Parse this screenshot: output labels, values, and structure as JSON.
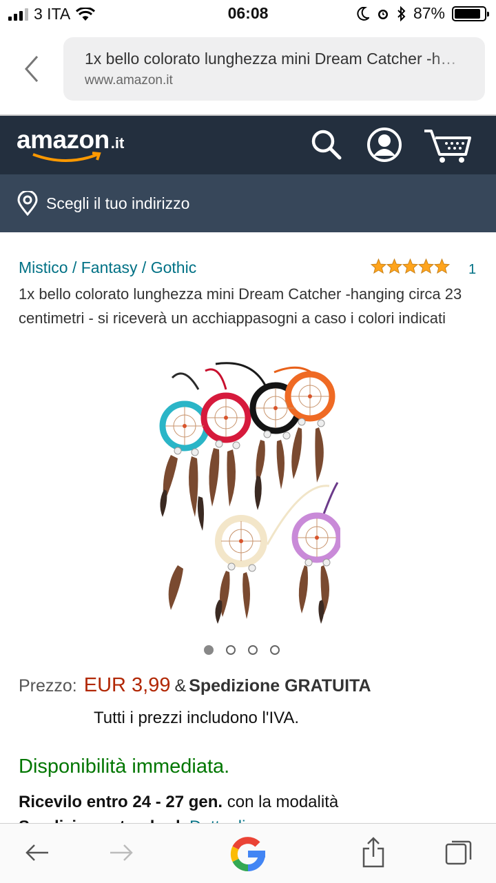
{
  "status": {
    "carrier": "3 ITA",
    "time": "06:08",
    "battery_pct": "87%",
    "battery_level": 0.87
  },
  "browser": {
    "page_title": "1x bello colorato lunghezza mini Dream Catcher -h…",
    "domain": "www.amazon.it"
  },
  "header": {
    "logo_word": "amazon",
    "logo_tld": ".it",
    "address_prompt": "Scegli il tuo indirizzo"
  },
  "product": {
    "brand": "Mistico / Fantasy / Gothic",
    "rating_stars": 5,
    "rating_count": "1",
    "title": "1x bello colorato lunghezza mini Dream Catcher -hanging circa 23 centimetri - si riceverà un acchiappasogni a caso i colori indicati",
    "image_count": 4,
    "active_image": 1,
    "price_label": "Prezzo:",
    "price": "EUR 3,99",
    "amp": "&",
    "shipping": "Spedizione GRATUITA",
    "vat_note": "Tutti i prezzi includono l'IVA.",
    "availability": "Disponibilità immediata.",
    "delivery_bold": "Ricevilo entro 24 - 27 gen.",
    "delivery_rest": "con la modalità",
    "delivery2_bold": "Spedizione standard.",
    "delivery2_link": "Dettagli"
  },
  "colors": {
    "amazon_dark": "#232f3e",
    "amazon_nav": "#37475a",
    "link": "#007185",
    "price": "#b12704",
    "in_stock": "#007600",
    "star": "#ffa41c"
  }
}
